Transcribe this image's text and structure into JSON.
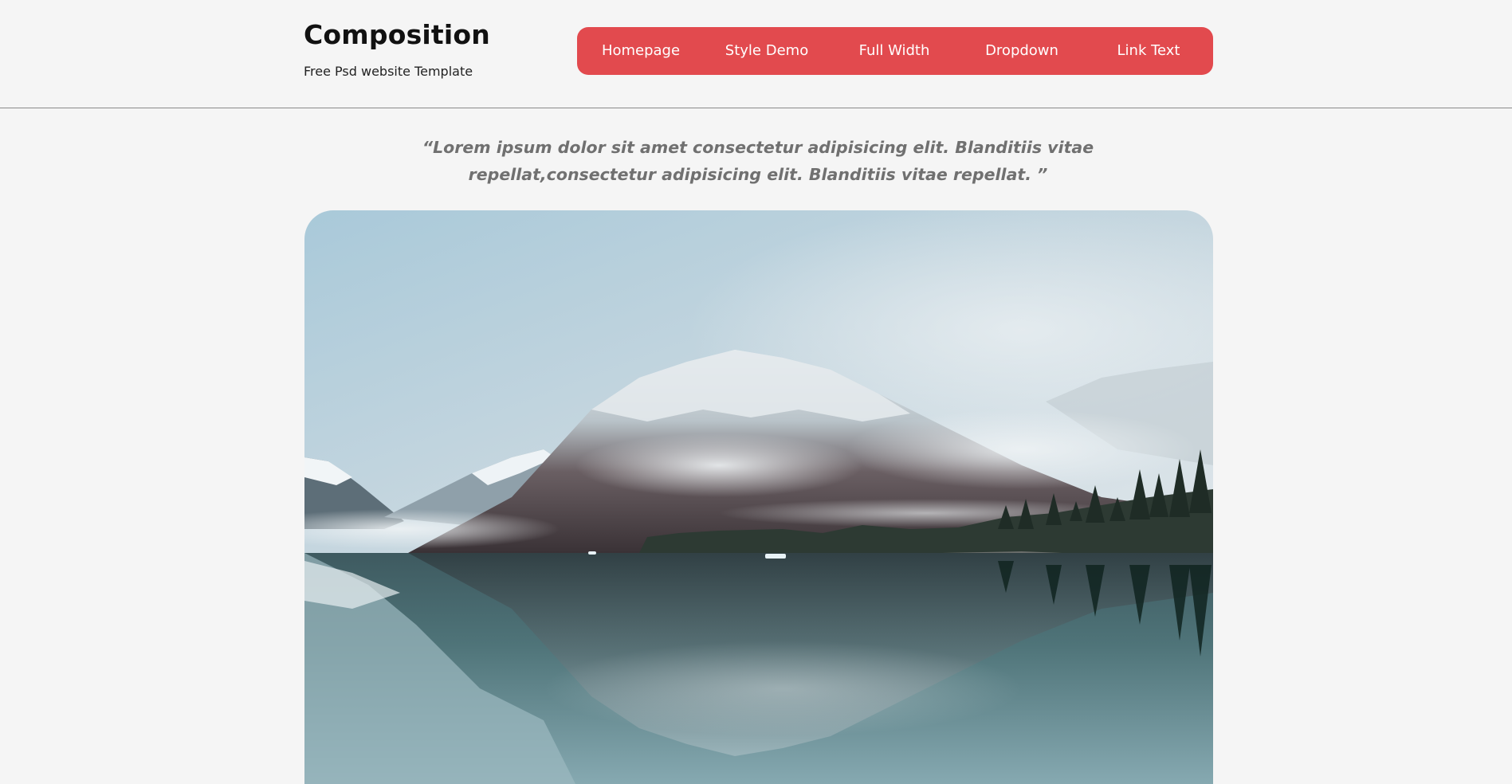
{
  "site": {
    "title": "Composition",
    "tagline": "Free Psd website Template"
  },
  "nav": {
    "items": [
      {
        "label": "Homepage"
      },
      {
        "label": "Style Demo"
      },
      {
        "label": "Full Width"
      },
      {
        "label": "Dropdown"
      },
      {
        "label": "Link Text"
      }
    ]
  },
  "quote": {
    "line1": "“Lorem ipsum dolor sit amet consectetur adipisicing elit. Blanditiis vitae",
    "line2": "repellat,consectetur adipisicing elit. Blanditiis vitae repellat. ”"
  },
  "colors": {
    "nav_background": "#e24a4e",
    "page_background": "#f5f5f5",
    "quote_text": "#707070"
  }
}
